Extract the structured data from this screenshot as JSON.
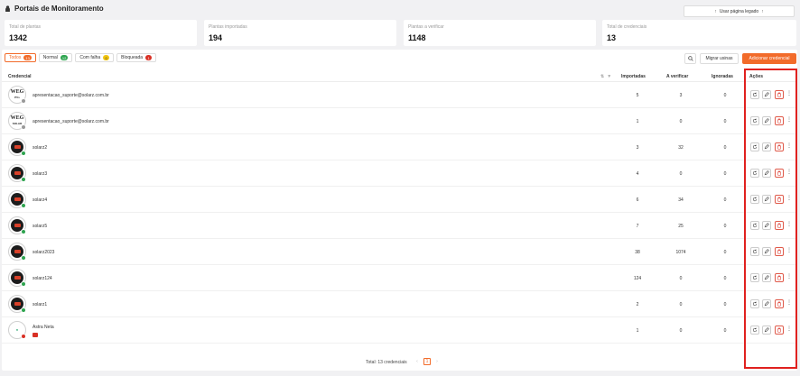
{
  "header": {
    "title": "Portais de Monitoramento",
    "legacy_button": "Usar página legado"
  },
  "stats": [
    {
      "label": "Total de plantas",
      "value": "1342"
    },
    {
      "label": "Plantas importadas",
      "value": "194"
    },
    {
      "label": "Plantas a verificar",
      "value": "1148"
    },
    {
      "label": "Total de credenciais",
      "value": "13"
    }
  ],
  "tabs": [
    {
      "label": "Todos",
      "count": "13",
      "color": "#f26b2a"
    },
    {
      "label": "Normal",
      "count": "12",
      "color": "#2ea44f"
    },
    {
      "label": "Com falha",
      "count": "0",
      "color": "#f1c40f"
    },
    {
      "label": "Bloqueada",
      "count": "1",
      "color": "#d93025"
    }
  ],
  "toolbar": {
    "migrate_label": "Migrar usinas",
    "add_label": "Adicionar credencial"
  },
  "table": {
    "columns": {
      "credential": "Credencial",
      "imported": "Importadas",
      "to_verify": "A verificar",
      "ignored": "Ignoradas",
      "actions": "Ações"
    },
    "rows": [
      {
        "name": "apresentacao_suporte@solarz.com.br",
        "avatar": "weg-pvs",
        "status": "gray",
        "imported": "5",
        "to_verify": "3",
        "ignored": "0"
      },
      {
        "name": "apresentacao_suporte@solarz.com.br",
        "avatar": "weg-solar",
        "status": "gray",
        "imported": "1",
        "to_verify": "0",
        "ignored": "0"
      },
      {
        "name": "solarz2",
        "avatar": "dark",
        "status": "ok",
        "imported": "3",
        "to_verify": "32",
        "ignored": "0"
      },
      {
        "name": "solarz3",
        "avatar": "dark",
        "status": "ok",
        "imported": "4",
        "to_verify": "0",
        "ignored": "0"
      },
      {
        "name": "solarz4",
        "avatar": "dark",
        "status": "ok",
        "imported": "6",
        "to_verify": "34",
        "ignored": "0"
      },
      {
        "name": "solarz5",
        "avatar": "dark",
        "status": "ok",
        "imported": "7",
        "to_verify": "25",
        "ignored": "0"
      },
      {
        "name": "solarz2023",
        "avatar": "dark",
        "status": "ok",
        "imported": "38",
        "to_verify": "1074",
        "ignored": "0"
      },
      {
        "name": "solarz124",
        "avatar": "dark",
        "status": "ok",
        "imported": "124",
        "to_verify": "0",
        "ignored": "0"
      },
      {
        "name": "solarz1",
        "avatar": "dark",
        "status": "ok",
        "imported": "2",
        "to_verify": "0",
        "ignored": "0"
      },
      {
        "name": "Astra Neta",
        "avatar": "astra",
        "status": "err",
        "imported": "1",
        "to_verify": "0",
        "ignored": "0"
      }
    ]
  },
  "footer": {
    "total": "Total: 13 credenciais",
    "current_page": "1",
    "prev": "‹",
    "next": "›"
  },
  "icons": {
    "header": "lock-icon",
    "legacy": "arrow-up-icon",
    "search": "search-icon",
    "filter": "filter-icon",
    "refresh": "refresh-icon",
    "edit": "edit-icon",
    "delete": "trash-icon",
    "more": "kebab-icon"
  },
  "colors": {
    "accent": "#f26b2a",
    "highlight": "#e0211f",
    "ok": "#2ea44f",
    "error": "#d93025"
  }
}
